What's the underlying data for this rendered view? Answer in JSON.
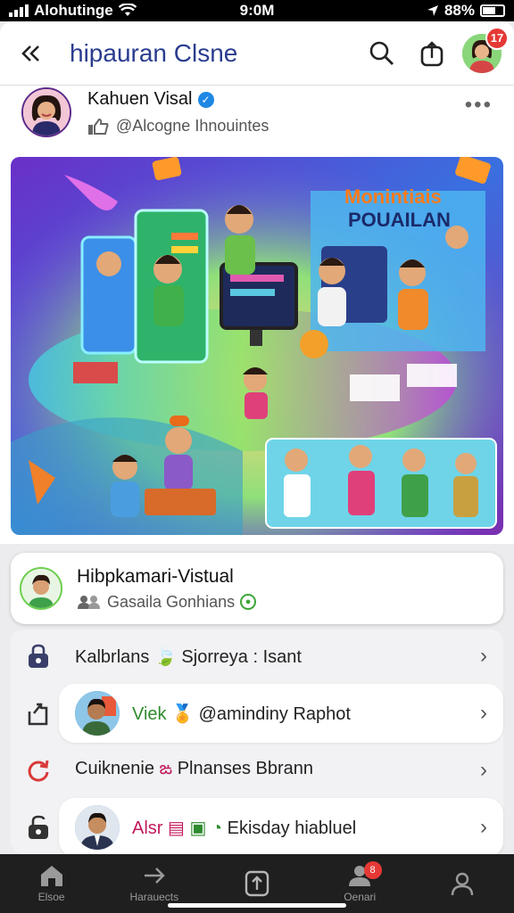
{
  "status_bar": {
    "carrier": "Alohutinge",
    "time": "9:0M",
    "battery": "88%"
  },
  "header": {
    "back_icon": "chevrons-left-icon",
    "title": "hipauran Clsne",
    "search_icon": "search-icon",
    "share_icon": "share-box-icon",
    "notification_count": "17"
  },
  "post": {
    "author_name": "Kahuen Visal",
    "author_handle": "@Alcogne Ihnouintes",
    "more_label": "•••",
    "image_banner_line1": "Monintiais",
    "image_banner_line2": "POUAILAN"
  },
  "user_card": {
    "name": "Hibpkamari-Vistual",
    "subtitle": "Gasaila Gonhians"
  },
  "list": {
    "items": [
      {
        "icon": "lock-icon",
        "text_a": "Kalbrlans",
        "text_b": "Sjorreya",
        "text_c": ": Isant",
        "chevron": "›"
      },
      {
        "icon": "share-icon",
        "text_a": "Viek",
        "text_b": "@amindiny Raphot",
        "chevron": "›"
      },
      {
        "icon": "refresh-icon",
        "text_a": "Cuiknenie",
        "text_b": "Plnanses",
        "text_c": "Bbrann",
        "chevron": "›"
      },
      {
        "icon": "unlock-icon",
        "text_a": "Alsr",
        "text_b": "Ekisday hiabluel",
        "chevron": "›"
      }
    ]
  },
  "bottom_nav": {
    "items": [
      {
        "label": "Elsoe",
        "icon": "home-icon"
      },
      {
        "label": "Harauects",
        "icon": "arrow-right-icon"
      },
      {
        "label": "",
        "icon": "upload-icon"
      },
      {
        "label": "Oenari",
        "icon": "people-icon",
        "badge": "8"
      },
      {
        "label": "",
        "icon": "profile-icon"
      }
    ]
  },
  "colors": {
    "accent": "#2a3d8f",
    "badge": "#e53935",
    "verified": "#1e88e5"
  }
}
